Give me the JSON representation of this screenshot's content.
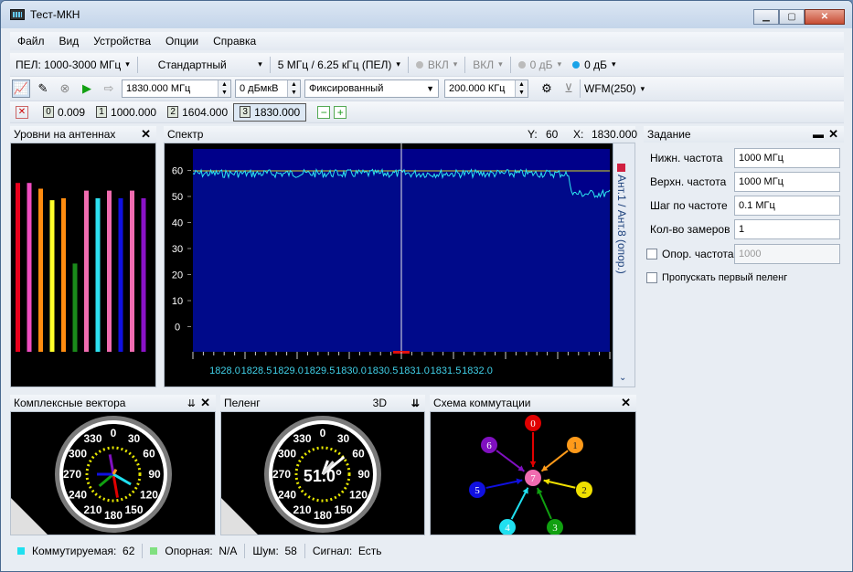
{
  "window": {
    "title": "Тест-МКН"
  },
  "menu": [
    "Файл",
    "Вид",
    "Устройства",
    "Опции",
    "Справка"
  ],
  "toolbar1": {
    "band": "ПЕЛ: 1000-3000 МГц",
    "mode": "Стандартный",
    "span": "5 МГц / 6.25 кГц (ПЕЛ)",
    "vkl1": "ВКЛ",
    "vkl2": "ВКЛ",
    "db1": "0 дБ",
    "db2": "0 дБ"
  },
  "toolbar2": {
    "freq": "1830.000 МГц",
    "level": "0 дБмкВ",
    "fix": "Фиксированный",
    "step": "200.000 КГц",
    "wfm": "WFM(250)"
  },
  "markers": [
    {
      "n": "0",
      "v": "0.009"
    },
    {
      "n": "1",
      "v": "1000.000"
    },
    {
      "n": "2",
      "v": "1604.000"
    },
    {
      "n": "3",
      "v": "1830.000"
    }
  ],
  "antenna_panel": {
    "title": "Уровни на антеннах",
    "bars": [
      {
        "color": "#e8001c",
        "level": 0.88
      },
      {
        "color": "#f04ec2",
        "level": 0.88
      },
      {
        "color": "#ff8c10",
        "level": 0.85
      },
      {
        "color": "#ffff2a",
        "level": 0.79
      },
      {
        "color": "#ff8c10",
        "level": 0.8
      },
      {
        "color": "#1a8a1a",
        "level": 0.46
      },
      {
        "color": "#f06cb0",
        "level": 0.84
      },
      {
        "color": "#2de0f0",
        "level": 0.8
      },
      {
        "color": "#f06cb0",
        "level": 0.84
      },
      {
        "color": "#1010e0",
        "level": 0.8
      },
      {
        "color": "#f06cb0",
        "level": 0.84
      },
      {
        "color": "#8b12c8",
        "level": 0.8
      }
    ]
  },
  "spectrum": {
    "title": "Спектр",
    "y_label": "Y:",
    "y_value": "60",
    "x_label": "X:",
    "x_value": "1830.000",
    "side_label": "Ант.1 / Ант.8 (опор.)",
    "yticks": [
      "60",
      "50",
      "40",
      "30",
      "20",
      "10",
      "0"
    ],
    "xticks": [
      "1828.0",
      "1828.5",
      "1829.0",
      "1829.5",
      "1830.0",
      "1830.5",
      "1831.0",
      "1831.5",
      "1832.0"
    ]
  },
  "task": {
    "title": "Задание",
    "rows": [
      {
        "label": "Нижн. частота",
        "value": "1000 МГц"
      },
      {
        "label": "Верхн. частота",
        "value": "1000 МГц"
      },
      {
        "label": "Шаг по частоте",
        "value": "0.1 МГц"
      },
      {
        "label": "Кол-во замеров",
        "value": "1"
      }
    ],
    "ref_label": "Опор. частота",
    "ref_value": "1000",
    "skip_label": "Пропускать первый пеленг"
  },
  "complex": {
    "title": "Комплексные вектора"
  },
  "bearing": {
    "title": "Пеленг",
    "mode": "3D",
    "value": "51.0°"
  },
  "dial_labels": [
    "0",
    "30",
    "60",
    "90",
    "120",
    "150",
    "180",
    "210",
    "240",
    "270",
    "300",
    "330"
  ],
  "scheme": {
    "title": "Схема коммутации",
    "center": "7",
    "nodes": [
      {
        "n": "0",
        "color": "#e00000"
      },
      {
        "n": "1",
        "color": "#ff9a1a"
      },
      {
        "n": "2",
        "color": "#f0e000"
      },
      {
        "n": "3",
        "color": "#10a010"
      },
      {
        "n": "4",
        "color": "#20e0f0"
      },
      {
        "n": "5",
        "color": "#1010e0"
      },
      {
        "n": "6",
        "color": "#8010c0"
      }
    ]
  },
  "status": {
    "sw_label": "Коммутируемая:",
    "sw_value": "62",
    "ref_label": "Опорная:",
    "ref_value": "N/A",
    "noise_label": "Шум:",
    "noise_value": "58",
    "signal_label": "Сигнал:",
    "signal_value": "Есть"
  }
}
